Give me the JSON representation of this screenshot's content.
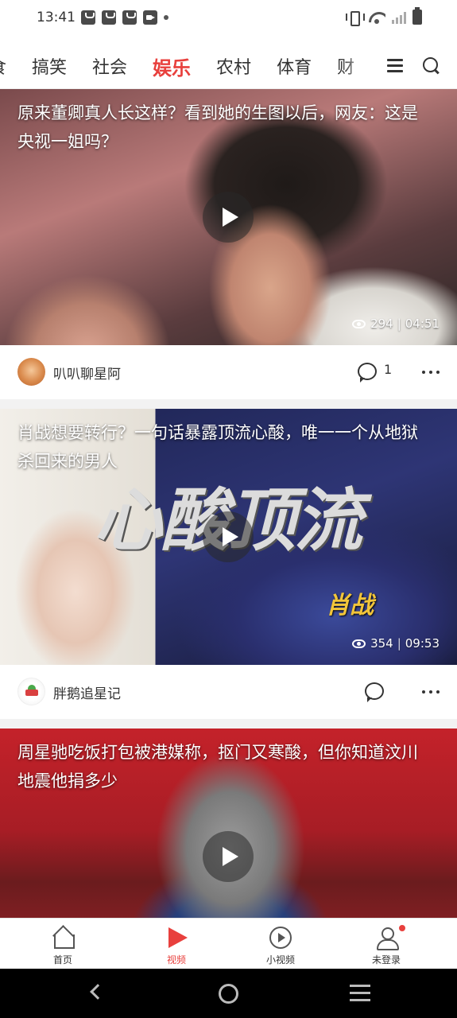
{
  "status_bar": {
    "time": "13:41"
  },
  "categories": {
    "tabs": [
      "食",
      "搞笑",
      "社会",
      "娱乐",
      "农村",
      "体育",
      "财"
    ],
    "active": "娱乐"
  },
  "feed": [
    {
      "title": "原来董卿真人长这样？看到她的生图以后，网友：这是央视一姐吗？",
      "views": "294",
      "duration": "04:51",
      "author": "叭叭聊星阿",
      "comments": "1"
    },
    {
      "title": "肖战想要转行？一句话暴露顶流心酸，唯一一个从地狱杀回来的男人",
      "thumbnail_text": "心酸顶流",
      "thumbnail_tag": "肖战",
      "views": "354",
      "duration": "09:53",
      "author": "胖鹅追星记",
      "comments": ""
    },
    {
      "title": "周星驰吃饭打包被港媒称，抠门又寒酸，但你知道汶川地震他捐多少"
    }
  ],
  "bottom_nav": {
    "items": [
      "首页",
      "视频",
      "小视频",
      "未登录"
    ],
    "active": "视频"
  },
  "colors": {
    "accent": "#e8403d"
  }
}
